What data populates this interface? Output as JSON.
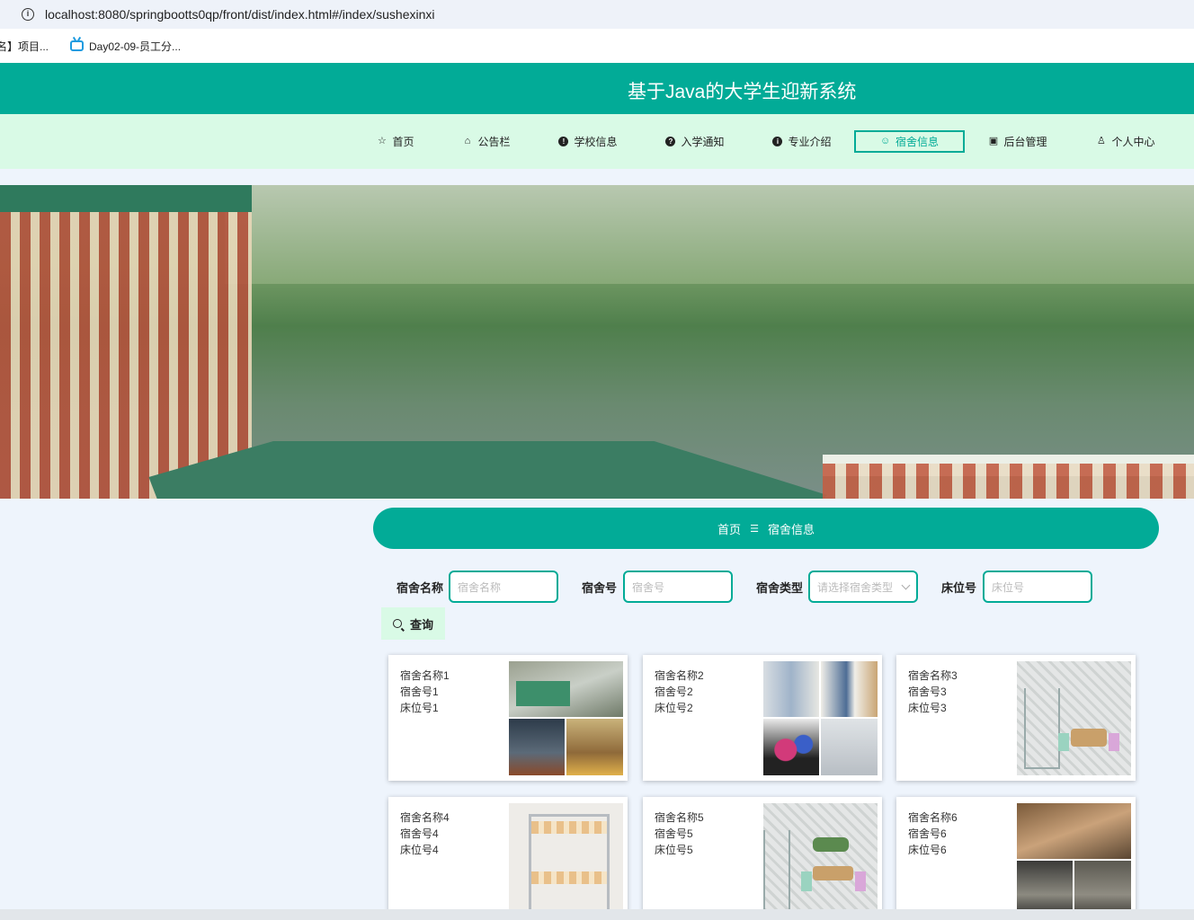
{
  "browser": {
    "url": "localhost:8080/springbootts0qp/front/dist/index.html#/index/sushexinxi",
    "bookmarks": [
      "名】项目...",
      "Day02-09-员工分..."
    ]
  },
  "header": {
    "title": "基于Java的大学生迎新系统"
  },
  "nav": {
    "items": [
      {
        "label": "首页",
        "icon": "star-icon"
      },
      {
        "label": "公告栏",
        "icon": "bag-icon"
      },
      {
        "label": "学校信息",
        "icon": "info-icon"
      },
      {
        "label": "入学通知",
        "icon": "question-icon"
      },
      {
        "label": "专业介绍",
        "icon": "info-icon"
      },
      {
        "label": "宿舍信息",
        "icon": "smile-icon",
        "active": true
      },
      {
        "label": "后台管理",
        "icon": "briefcase-icon"
      },
      {
        "label": "个人中心",
        "icon": "user-icon"
      }
    ]
  },
  "breadcrumb": {
    "home": "首页",
    "separator": "☰",
    "current": "宿舍信息"
  },
  "search": {
    "fields": [
      {
        "label": "宿舍名称",
        "placeholder": "宿舍名称"
      },
      {
        "label": "宿舍号",
        "placeholder": "宿舍号"
      },
      {
        "label": "宿舍类型",
        "placeholder": "请选择宿舍类型"
      },
      {
        "label": "床位号",
        "placeholder": "床位号"
      }
    ],
    "button_label": "查询"
  },
  "cards": [
    {
      "name": "宿舍名称1",
      "number": "宿舍号1",
      "bed": "床位号1"
    },
    {
      "name": "宿舍名称2",
      "number": "宿舍号2",
      "bed": "床位号2"
    },
    {
      "name": "宿舍名称3",
      "number": "宿舍号3",
      "bed": "床位号3"
    },
    {
      "name": "宿舍名称4",
      "number": "宿舍号4",
      "bed": "床位号4"
    },
    {
      "name": "宿舍名称5",
      "number": "宿舍号5",
      "bed": "床位号5"
    },
    {
      "name": "宿舍名称6",
      "number": "宿舍号6",
      "bed": "床位号6"
    }
  ],
  "colors": {
    "primary": "#02ab97",
    "nav_bg": "#d9fae6",
    "page_bg": "#eef4fc"
  }
}
